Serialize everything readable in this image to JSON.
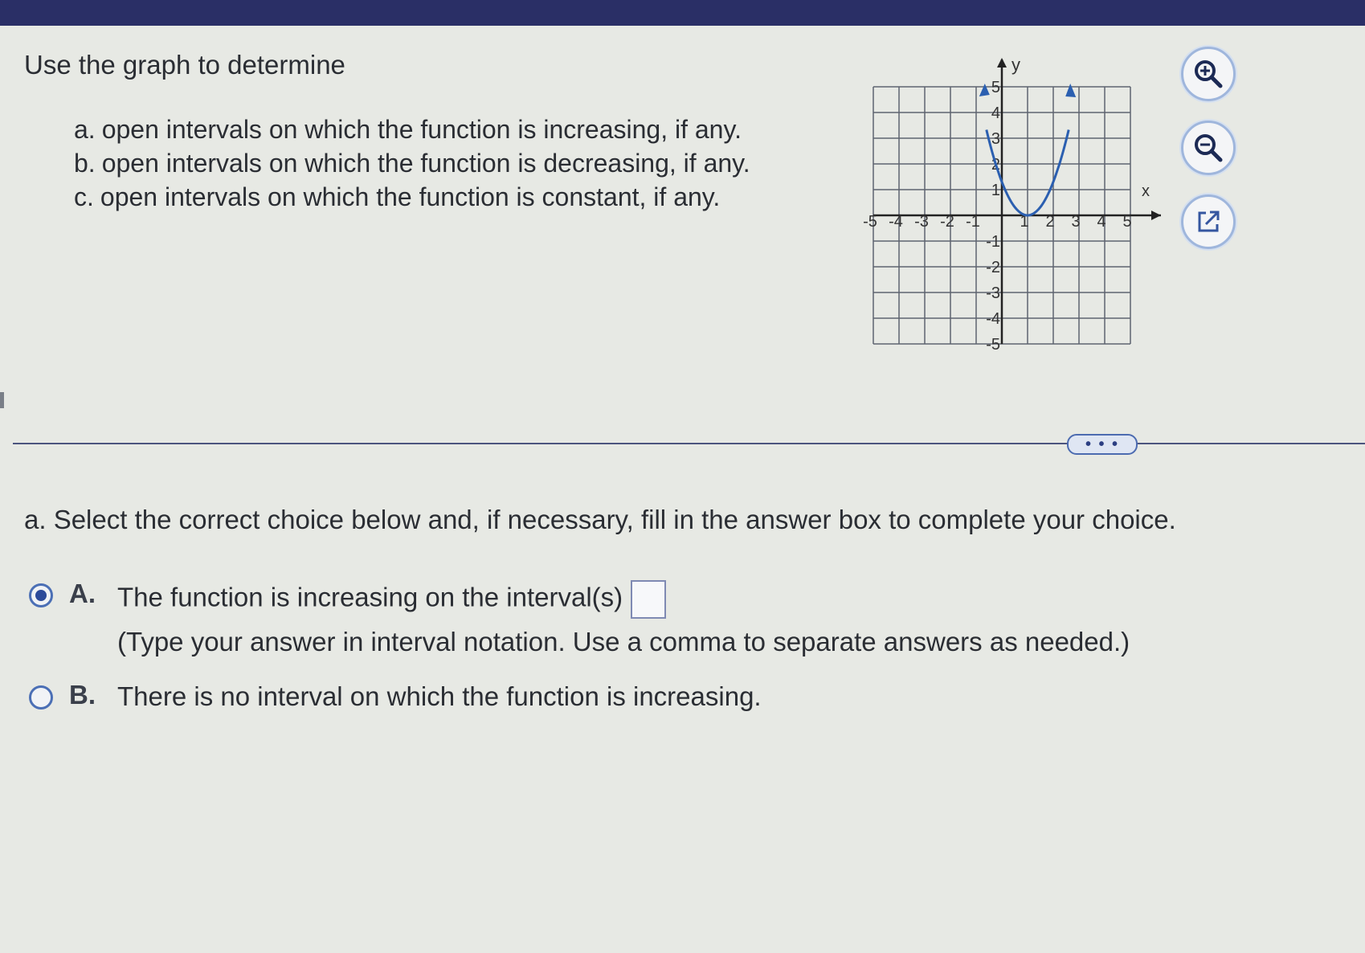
{
  "question": {
    "prompt": "Use the graph to determine",
    "parts": [
      {
        "letter": "a.",
        "text": "open intervals on which the function is increasing, if any."
      },
      {
        "letter": "b.",
        "text": "open intervals on which the function is decreasing, if any."
      },
      {
        "letter": "c.",
        "text": "open intervals on which the function is constant, if any."
      }
    ]
  },
  "graph": {
    "axis_x_label": "x",
    "axis_y_label": "y",
    "x_ticks": [
      "-5",
      "-4",
      "-3",
      "-2",
      "-1",
      "1",
      "2",
      "3",
      "4",
      "5"
    ],
    "y_ticks": [
      "5",
      "4",
      "3",
      "2",
      "1",
      "-1",
      "-2",
      "-3",
      "-4",
      "-5"
    ],
    "curve_color": "#2b5fb0",
    "function_points": [
      {
        "x": -0.6,
        "y": 5
      },
      {
        "x": 0,
        "y": 2
      },
      {
        "x": 0.5,
        "y": 0.3
      },
      {
        "x": 1,
        "y": 0
      },
      {
        "x": 1.5,
        "y": 0.3
      },
      {
        "x": 2,
        "y": 1.3
      },
      {
        "x": 2.6,
        "y": 5
      }
    ]
  },
  "tools": {
    "zoom_in": "zoom-in-icon",
    "zoom_out": "zoom-out-icon",
    "popout": "popout-icon"
  },
  "more_button": "• • •",
  "part_a": {
    "prompt": "a. Select the correct choice below and, if necessary, fill in the answer box to complete your choice.",
    "choices": [
      {
        "letter": "A.",
        "text": "The function is increasing on the interval(s)",
        "hint": "(Type your answer in interval notation. Use a comma to separate answers as needed.)",
        "selected": true,
        "answer_value": ""
      },
      {
        "letter": "B.",
        "text": "There is no interval on which the function is increasing.",
        "selected": false
      }
    ]
  }
}
